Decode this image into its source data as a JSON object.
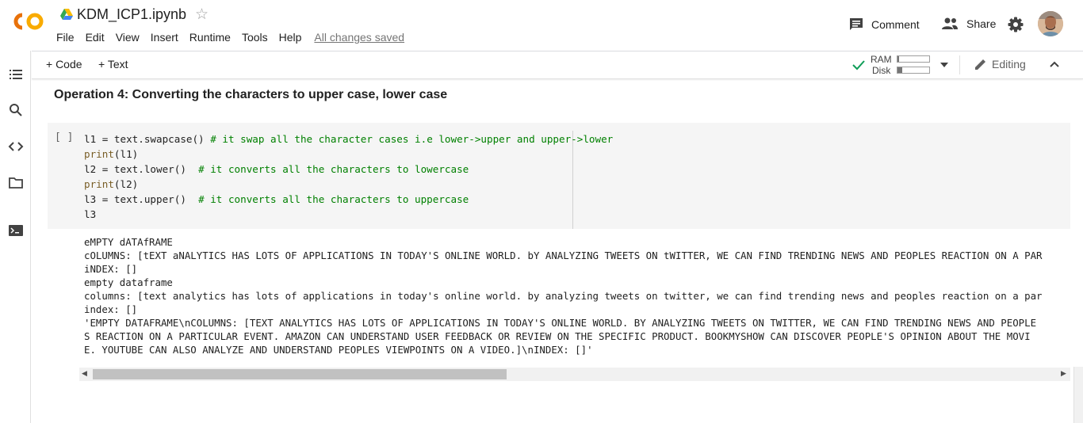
{
  "header": {
    "notebook_title": "KDM_ICP1.ipynb",
    "menu": [
      "File",
      "Edit",
      "View",
      "Insert",
      "Runtime",
      "Tools",
      "Help"
    ],
    "save_status": "All changes saved",
    "comment_label": "Comment",
    "share_label": "Share"
  },
  "toolbar": {
    "add_code_label": "+ Code",
    "add_text_label": "+ Text",
    "ram_label": "RAM",
    "disk_label": "Disk",
    "ram_usage": 0.05,
    "disk_usage": 0.15,
    "editing_label": "Editing"
  },
  "content": {
    "section_heading": "Operation 4: Converting the characters to upper case, lower case",
    "run_indicator": "[ ]",
    "code_lines": [
      {
        "code": "l1 = text.swapcase() ",
        "comment": "# it swap all the character cases i.e lower->upper and upper->lower"
      },
      {
        "fn": "print",
        "code": "(l1)"
      },
      {
        "code": "l2 = text.lower()  ",
        "comment": "# it converts all the characters to lowercase"
      },
      {
        "fn": "print",
        "code": "(l2)"
      },
      {
        "code": "l3 = text.upper()  ",
        "comment": "# it converts all the characters to uppercase"
      },
      {
        "code": "l3"
      }
    ],
    "output_lines": [
      "eMPTY dATAfRAME",
      "cOLUMNS: [tEXT aNALYTICS HAS LOTS OF APPLICATIONS IN TODAY'S ONLINE WORLD. bY ANALYZING TWEETS ON tWITTER, WE CAN FIND TRENDING NEWS AND PEOPLES REACTION ON A PAR",
      "iNDEX: []",
      "empty dataframe",
      "columns: [text analytics has lots of applications in today's online world. by analyzing tweets on twitter, we can find trending news and peoples reaction on a par",
      "index: []",
      "'EMPTY DATAFRAME\\nCOLUMNS: [TEXT ANALYTICS HAS LOTS OF APPLICATIONS IN TODAY'S ONLINE WORLD. BY ANALYZING TWEETS ON TWITTER, WE CAN FIND TRENDING NEWS AND PEOPLE",
      "S REACTION ON A PARTICULAR EVENT. AMAZON CAN UNDERSTAND USER FEEDBACK OR REVIEW ON THE SPECIFIC PRODUCT. BOOKMYSHOW CAN DISCOVER PEOPLE'S OPINION ABOUT THE MOVI",
      "E. YOUTUBE CAN ALSO ANALYZE AND UNDERSTAND PEOPLES VIEWPOINTS ON A VIDEO.]\\nINDEX: []'"
    ]
  },
  "icons": [
    "colab-logo",
    "drive-icon",
    "star-icon",
    "comment-icon",
    "share-icon",
    "gear-icon",
    "avatar",
    "toc-icon",
    "search-icon",
    "code-snippets-icon",
    "files-icon",
    "terminal-icon",
    "check-icon",
    "chevron-down-icon",
    "pencil-icon",
    "chevron-up-icon"
  ],
  "colors": {
    "logo_orange": "#F9AB00",
    "logo_dark_orange": "#E8710A",
    "check_green": "#0F9D58",
    "comment_green": "#008000"
  }
}
